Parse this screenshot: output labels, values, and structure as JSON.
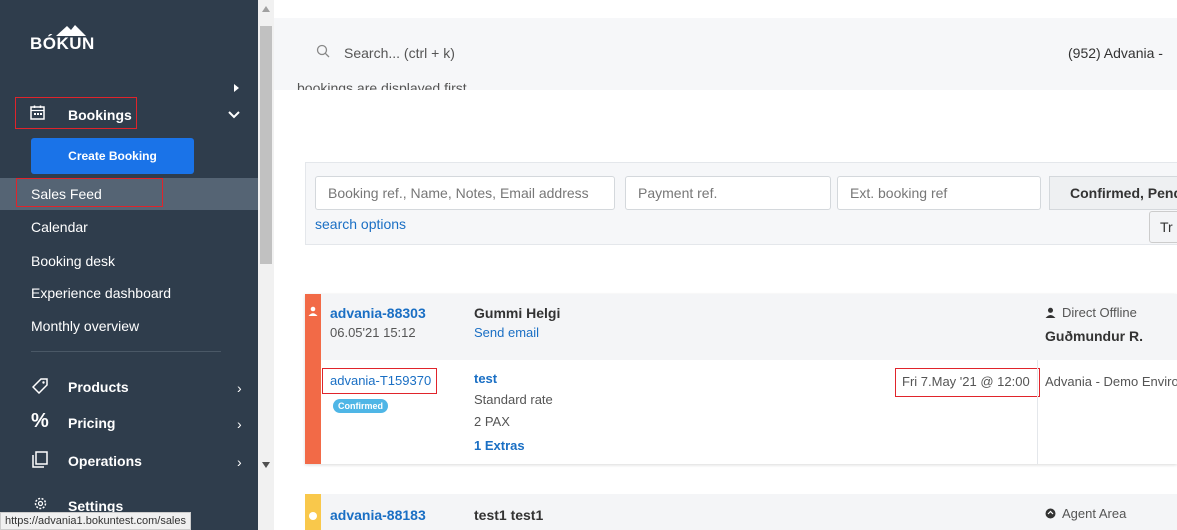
{
  "sidebar": {
    "logo": "BÓKUN",
    "bookings_label": "Bookings",
    "create_booking_label": "Create Booking",
    "sub_items": [
      {
        "label": "Sales Feed"
      },
      {
        "label": "Calendar"
      },
      {
        "label": "Booking desk"
      },
      {
        "label": "Experience dashboard"
      },
      {
        "label": "Monthly overview"
      }
    ],
    "main_items": [
      {
        "label": "Products",
        "icon": "tag-icon"
      },
      {
        "label": "Pricing",
        "icon": "percent-icon"
      },
      {
        "label": "Operations",
        "icon": "copy-icon"
      },
      {
        "label": "Settings",
        "icon": "gear-icon"
      }
    ],
    "background": "#2f3d4c",
    "button_color": "#1a73e8"
  },
  "status_bar_url": "https://advania1.bokuntest.com/sales",
  "topbar": {
    "search_placeholder": "Search... (ctrl + k)",
    "account": "(952) Advania -"
  },
  "clipped_text": "bookings are displayed first.",
  "filters": {
    "booking_ref_placeholder": "Booking ref., Name, Notes, Email address",
    "payment_ref_placeholder": "Payment ref.",
    "ext_booking_ref_placeholder": "Ext. booking ref",
    "status_filter": "Confirmed, Pend",
    "search_options": "search options",
    "tr_button": "Tr"
  },
  "bookings": [
    {
      "ref": "advania-88303",
      "datetime": "06.05'21 15:12",
      "customer": "Gummi Helgi",
      "send_email": "Send email",
      "channel": "Direct Offline",
      "seller": "Guðmundur R.",
      "item_ref": "advania-T159370",
      "status": "Confirmed",
      "product": "test",
      "rate": "Standard rate",
      "pax": "2 PAX",
      "extras": "1 Extras",
      "date": "Fri 7.May '21 @ 12:00",
      "vendor": "Advania - Demo Enviro",
      "strip_color": "#f26a47"
    },
    {
      "ref": "advania-88183",
      "customer": "test1 test1",
      "channel": "Agent Area",
      "strip_color": "#f9c84b"
    }
  ]
}
